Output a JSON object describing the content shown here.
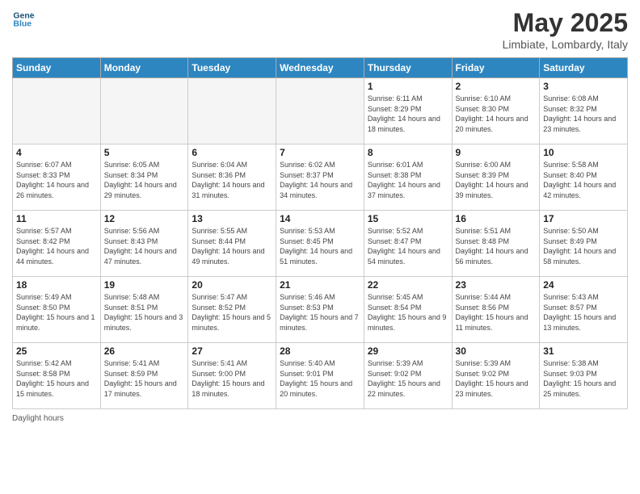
{
  "logo": {
    "text1": "General",
    "text2": "Blue"
  },
  "title": "May 2025",
  "location": "Limbiate, Lombardy, Italy",
  "days_of_week": [
    "Sunday",
    "Monday",
    "Tuesday",
    "Wednesday",
    "Thursday",
    "Friday",
    "Saturday"
  ],
  "footer": "Daylight hours",
  "weeks": [
    [
      {
        "day": "",
        "info": ""
      },
      {
        "day": "",
        "info": ""
      },
      {
        "day": "",
        "info": ""
      },
      {
        "day": "",
        "info": ""
      },
      {
        "day": "1",
        "info": "Sunrise: 6:11 AM\nSunset: 8:29 PM\nDaylight: 14 hours\nand 18 minutes."
      },
      {
        "day": "2",
        "info": "Sunrise: 6:10 AM\nSunset: 8:30 PM\nDaylight: 14 hours\nand 20 minutes."
      },
      {
        "day": "3",
        "info": "Sunrise: 6:08 AM\nSunset: 8:32 PM\nDaylight: 14 hours\nand 23 minutes."
      }
    ],
    [
      {
        "day": "4",
        "info": "Sunrise: 6:07 AM\nSunset: 8:33 PM\nDaylight: 14 hours\nand 26 minutes."
      },
      {
        "day": "5",
        "info": "Sunrise: 6:05 AM\nSunset: 8:34 PM\nDaylight: 14 hours\nand 29 minutes."
      },
      {
        "day": "6",
        "info": "Sunrise: 6:04 AM\nSunset: 8:36 PM\nDaylight: 14 hours\nand 31 minutes."
      },
      {
        "day": "7",
        "info": "Sunrise: 6:02 AM\nSunset: 8:37 PM\nDaylight: 14 hours\nand 34 minutes."
      },
      {
        "day": "8",
        "info": "Sunrise: 6:01 AM\nSunset: 8:38 PM\nDaylight: 14 hours\nand 37 minutes."
      },
      {
        "day": "9",
        "info": "Sunrise: 6:00 AM\nSunset: 8:39 PM\nDaylight: 14 hours\nand 39 minutes."
      },
      {
        "day": "10",
        "info": "Sunrise: 5:58 AM\nSunset: 8:40 PM\nDaylight: 14 hours\nand 42 minutes."
      }
    ],
    [
      {
        "day": "11",
        "info": "Sunrise: 5:57 AM\nSunset: 8:42 PM\nDaylight: 14 hours\nand 44 minutes."
      },
      {
        "day": "12",
        "info": "Sunrise: 5:56 AM\nSunset: 8:43 PM\nDaylight: 14 hours\nand 47 minutes."
      },
      {
        "day": "13",
        "info": "Sunrise: 5:55 AM\nSunset: 8:44 PM\nDaylight: 14 hours\nand 49 minutes."
      },
      {
        "day": "14",
        "info": "Sunrise: 5:53 AM\nSunset: 8:45 PM\nDaylight: 14 hours\nand 51 minutes."
      },
      {
        "day": "15",
        "info": "Sunrise: 5:52 AM\nSunset: 8:47 PM\nDaylight: 14 hours\nand 54 minutes."
      },
      {
        "day": "16",
        "info": "Sunrise: 5:51 AM\nSunset: 8:48 PM\nDaylight: 14 hours\nand 56 minutes."
      },
      {
        "day": "17",
        "info": "Sunrise: 5:50 AM\nSunset: 8:49 PM\nDaylight: 14 hours\nand 58 minutes."
      }
    ],
    [
      {
        "day": "18",
        "info": "Sunrise: 5:49 AM\nSunset: 8:50 PM\nDaylight: 15 hours\nand 1 minute."
      },
      {
        "day": "19",
        "info": "Sunrise: 5:48 AM\nSunset: 8:51 PM\nDaylight: 15 hours\nand 3 minutes."
      },
      {
        "day": "20",
        "info": "Sunrise: 5:47 AM\nSunset: 8:52 PM\nDaylight: 15 hours\nand 5 minutes."
      },
      {
        "day": "21",
        "info": "Sunrise: 5:46 AM\nSunset: 8:53 PM\nDaylight: 15 hours\nand 7 minutes."
      },
      {
        "day": "22",
        "info": "Sunrise: 5:45 AM\nSunset: 8:54 PM\nDaylight: 15 hours\nand 9 minutes."
      },
      {
        "day": "23",
        "info": "Sunrise: 5:44 AM\nSunset: 8:56 PM\nDaylight: 15 hours\nand 11 minutes."
      },
      {
        "day": "24",
        "info": "Sunrise: 5:43 AM\nSunset: 8:57 PM\nDaylight: 15 hours\nand 13 minutes."
      }
    ],
    [
      {
        "day": "25",
        "info": "Sunrise: 5:42 AM\nSunset: 8:58 PM\nDaylight: 15 hours\nand 15 minutes."
      },
      {
        "day": "26",
        "info": "Sunrise: 5:41 AM\nSunset: 8:59 PM\nDaylight: 15 hours\nand 17 minutes."
      },
      {
        "day": "27",
        "info": "Sunrise: 5:41 AM\nSunset: 9:00 PM\nDaylight: 15 hours\nand 18 minutes."
      },
      {
        "day": "28",
        "info": "Sunrise: 5:40 AM\nSunset: 9:01 PM\nDaylight: 15 hours\nand 20 minutes."
      },
      {
        "day": "29",
        "info": "Sunrise: 5:39 AM\nSunset: 9:02 PM\nDaylight: 15 hours\nand 22 minutes."
      },
      {
        "day": "30",
        "info": "Sunrise: 5:39 AM\nSunset: 9:02 PM\nDaylight: 15 hours\nand 23 minutes."
      },
      {
        "day": "31",
        "info": "Sunrise: 5:38 AM\nSunset: 9:03 PM\nDaylight: 15 hours\nand 25 minutes."
      }
    ]
  ]
}
